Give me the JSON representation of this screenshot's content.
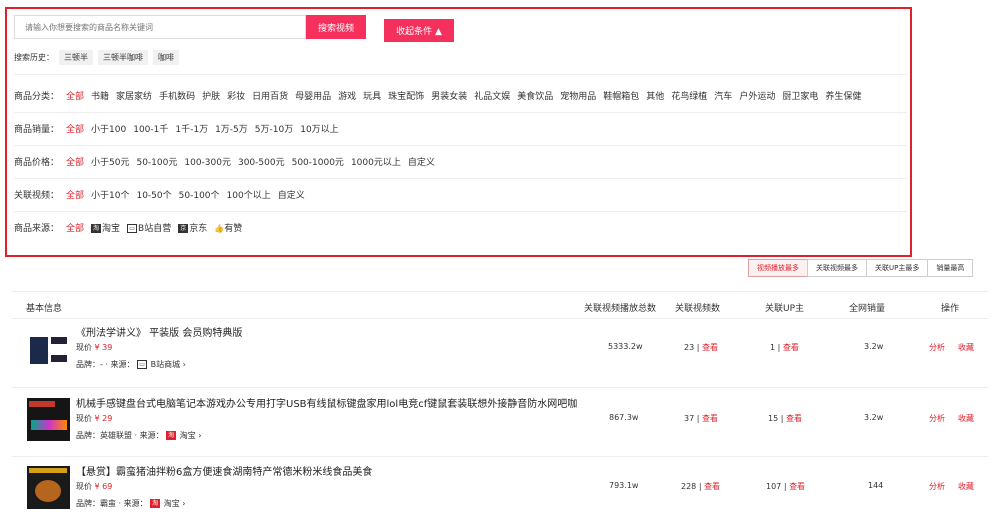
{
  "search": {
    "placeholder": "请输入你想要搜索的商品名称关键词",
    "button": "搜索视频",
    "collapse": "收起条件 ▲",
    "history_label": "搜索历史：",
    "history": [
      "三顿半",
      "三顿半咖啡",
      "咖啡"
    ]
  },
  "filters": [
    {
      "label": "商品分类：",
      "options": [
        "全部",
        "书籍",
        "家居家纺",
        "手机数码",
        "护肤",
        "彩妆",
        "日用百货",
        "母婴用品",
        "游戏",
        "玩具",
        "珠宝配饰",
        "男装女装",
        "礼品文娱",
        "美食饮品",
        "宠物用品",
        "鞋帽箱包",
        "其他",
        "花鸟绿植",
        "汽车",
        "户外运动",
        "厨卫家电",
        "养生保健"
      ]
    },
    {
      "label": "商品销量：",
      "options": [
        "全部",
        "小于100",
        "100-1千",
        "1千-1万",
        "1万-5万",
        "5万-10万",
        "10万以上"
      ]
    },
    {
      "label": "商品价格：",
      "options": [
        "全部",
        "小于50元",
        "50-100元",
        "100-300元",
        "300-500元",
        "500-1000元",
        "1000元以上",
        "自定义"
      ]
    },
    {
      "label": "关联视频：",
      "options": [
        "全部",
        "小于10个",
        "10-50个",
        "50-100个",
        "100个以上",
        "自定义"
      ]
    }
  ],
  "source": {
    "label": "商品来源：",
    "all": "全部",
    "taobao_icon": "淘",
    "taobao": "淘宝",
    "bilibili": "B站自营",
    "jd_icon": "京",
    "jd": "京东",
    "youzan": "有赞"
  },
  "sort": [
    "视频播放最多",
    "关联视频最多",
    "关联UP主最多",
    "销量最高"
  ],
  "table": {
    "headers": [
      "基本信息",
      "关联视频播放总数",
      "关联视频数",
      "关联UP主",
      "全网销量",
      "操作"
    ],
    "price_label": "现价",
    "brand_label": "品牌：",
    "source_label": "来源：",
    "view": "查看",
    "analyze": "分析",
    "favorite": "收藏",
    "rows": [
      {
        "title": "《刑法学讲义》 平装版 会员购特典版",
        "price": "¥ 39",
        "brand": "-",
        "source": "B站商城",
        "plays": "5333.2w",
        "videos": "23",
        "ups": "1",
        "sales": "3.2w"
      },
      {
        "title": "机械手感键盘台式电脑笔记本游戏办公专用打字USB有线鼠标键盘家用lol电竞cf键鼠套装联想外接静音防水网吧咖",
        "price": "¥ 29",
        "brand": "英雄联盟",
        "source": "淘宝",
        "plays": "867.3w",
        "videos": "37",
        "ups": "15",
        "sales": "3.2w"
      },
      {
        "title": "【悬赏】霸蛮猪油拌粉6盒方便速食湖南特产常德米粉米线食品美食",
        "price": "¥ 69",
        "brand": "霸蛮",
        "source": "淘宝",
        "plays": "793.1w",
        "videos": "228",
        "ups": "107",
        "sales": "144"
      }
    ]
  },
  "colors": {
    "accent": "#f5305c",
    "border": "#e0202c",
    "link": "#e0202c"
  }
}
